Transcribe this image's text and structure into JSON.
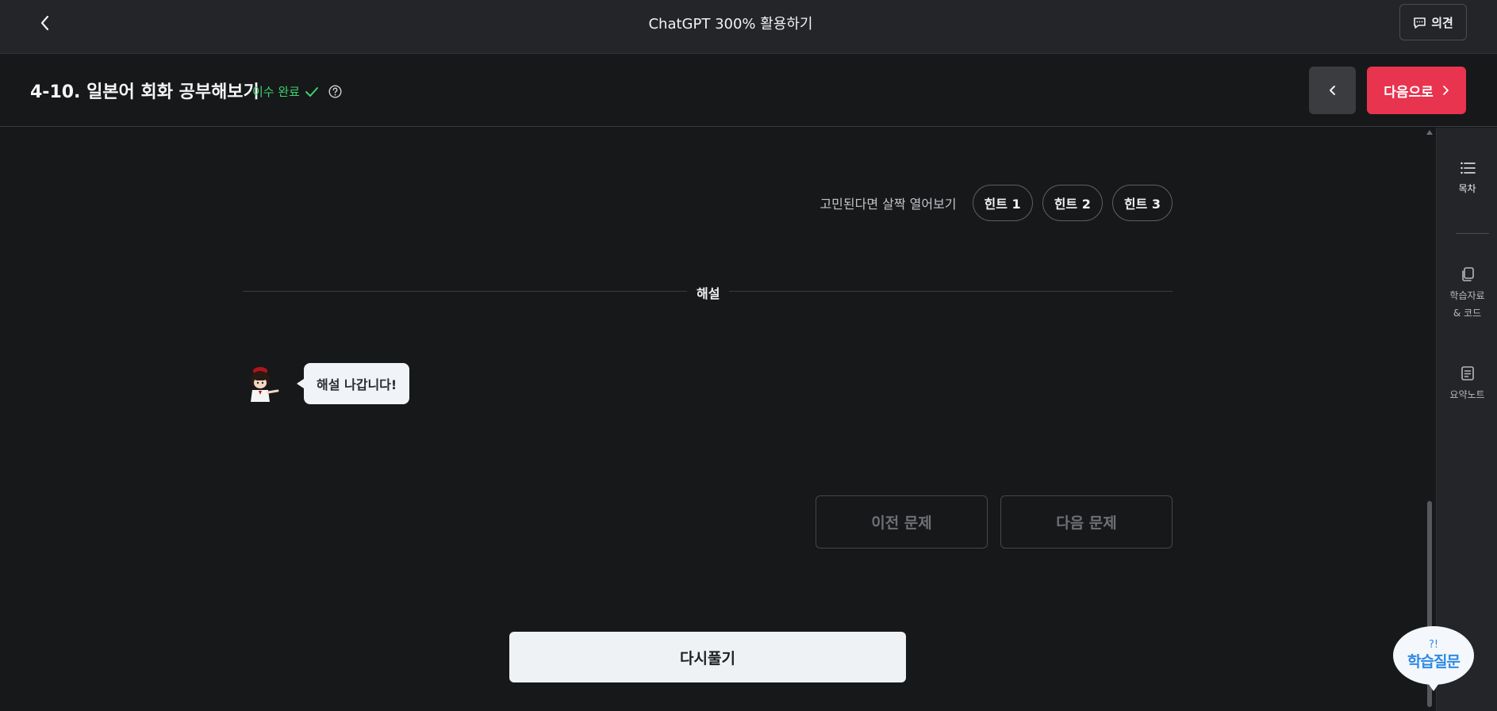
{
  "header": {
    "title": "ChatGPT 300% 활용하기",
    "feedback_label": "의견"
  },
  "lesson": {
    "title": "4-10. 일본어 회화 공부해보기",
    "status": "이수 완료",
    "next_label": "다음으로"
  },
  "hints": {
    "caption": "고민된다면 살짝 열어보기",
    "buttons": [
      "힌트 1",
      "힌트 2",
      "힌트 3"
    ]
  },
  "explanation": {
    "section_label": "해설",
    "bubble_text": "해설 나갑니다!"
  },
  "navigation": {
    "prev_question": "이전 문제",
    "next_question": "다음 문제"
  },
  "retry_label": "다시풀기",
  "sidebar": {
    "items": [
      {
        "label": "목차",
        "icon": "list-icon"
      },
      {
        "label": "학습자료\n& 코드",
        "icon": "copy-icon"
      },
      {
        "label": "요약노트",
        "icon": "note-icon"
      }
    ]
  },
  "ask_button": {
    "label": "학습질문",
    "marks": "?!"
  },
  "colors": {
    "accent": "#e8344e",
    "success": "#3ed16a",
    "ask": "#2e8ae6"
  }
}
